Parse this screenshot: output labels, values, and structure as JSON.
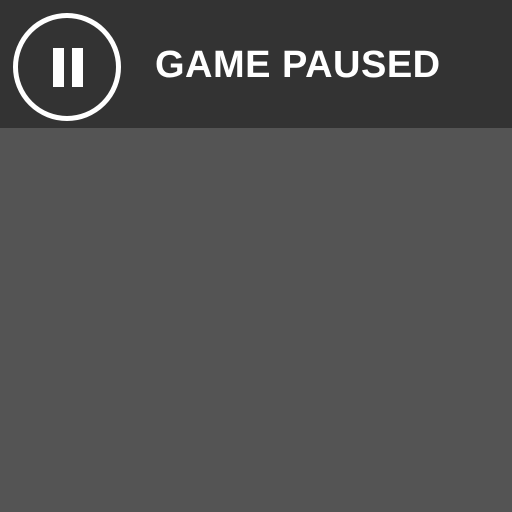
{
  "hud": {
    "status_label": "GAME PAUSED",
    "pause_icon": "pause-icon"
  },
  "colors": {
    "bar_background": "#333333",
    "game_background": "#545454",
    "foreground": "#ffffff"
  }
}
